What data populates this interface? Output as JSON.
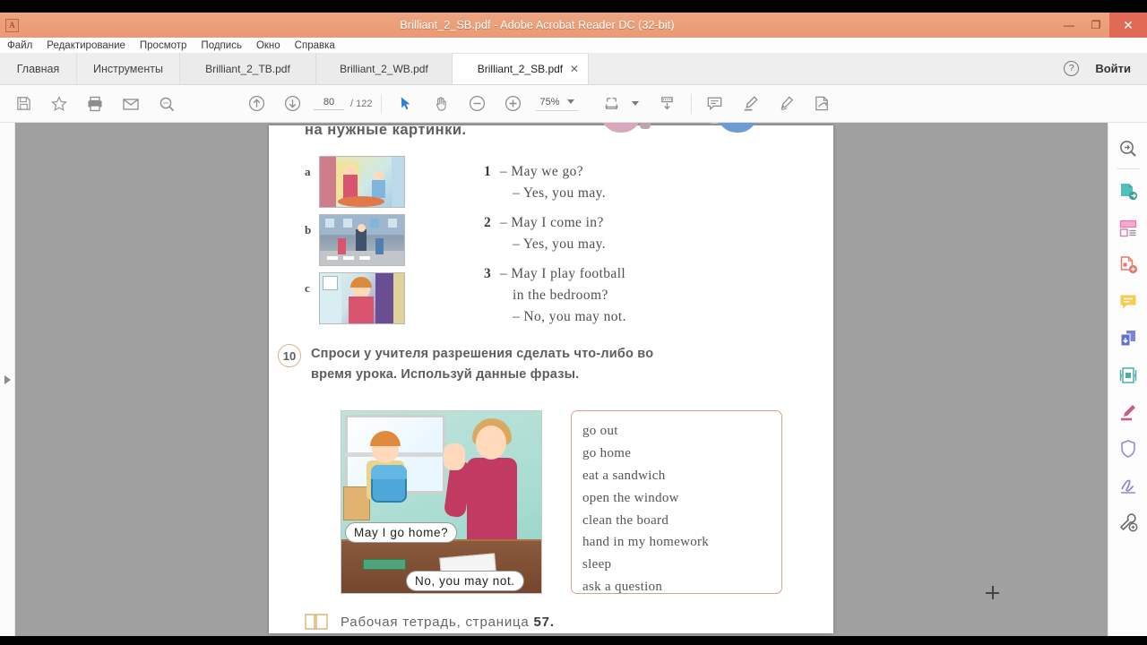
{
  "window": {
    "title": "Brilliant_2_SB.pdf - Adobe Acrobat Reader DC (32-bit)",
    "logo_letter": "A",
    "minimize": "—",
    "maximize": "❐",
    "close": "✕",
    "titlebar_color": "#e99a74"
  },
  "menubar": {
    "items": [
      {
        "label": "Файл"
      },
      {
        "label": "Редактирование"
      },
      {
        "label": "Просмотр"
      },
      {
        "label": "Подпись"
      },
      {
        "label": "Окно"
      },
      {
        "label": "Справка"
      }
    ]
  },
  "tabbar": {
    "nav": [
      {
        "label": "Главная"
      },
      {
        "label": "Инструменты"
      }
    ],
    "documents": [
      {
        "label": "Brilliant_2_TB.pdf",
        "active": false
      },
      {
        "label": "Brilliant_2_WB.pdf",
        "active": false
      },
      {
        "label": "Brilliant_2_SB.pdf",
        "active": true,
        "close": "✕"
      }
    ],
    "help_glyph": "?",
    "signin_label": "Войти"
  },
  "toolbar": {
    "icons_left": [
      "save-icon",
      "bookmark-star-icon",
      "print-icon",
      "email-icon",
      "search-icon"
    ],
    "page_prev": "previous-page-icon",
    "page_next": "next-page-icon",
    "page_current": "80",
    "page_separator": "/",
    "page_total": "122",
    "select_tool": "select-arrow-icon",
    "hand_tool": "hand-tool-icon",
    "zoom_out": "zoom-out-icon",
    "zoom_in": "zoom-in-icon",
    "zoom_value": "75%",
    "fit_page": "fit-page-icon",
    "page_display": "page-display-icon",
    "comment": "comment-icon",
    "highlight": "highlight-icon",
    "sign": "sign-pen-icon",
    "fill_sign": "fill-and-sign-icon"
  },
  "document": {
    "heading": "на нужные картинки.",
    "exercise9": {
      "pictures": [
        {
          "letter": "a"
        },
        {
          "letter": "b"
        },
        {
          "letter": "c"
        }
      ],
      "dialogues": [
        {
          "num": "1",
          "lines": [
            "– May  we  go?",
            "– Yes,  you  may."
          ]
        },
        {
          "num": "2",
          "lines": [
            "– May  I  come  in?",
            "– Yes,  you  may."
          ]
        },
        {
          "num": "3",
          "lines": [
            "– May  I  play  football",
            "in  the  bedroom?",
            "– No,  you  may  not."
          ]
        }
      ]
    },
    "exercise10": {
      "number": "10",
      "instruction": "Спроси у учителя разрешения сделать что-либо во время урока. Используй данные фразы.",
      "scene": {
        "bubble_student": "May  I  go  home?",
        "bubble_teacher": "No,  you  may  not."
      },
      "phrases": [
        "go out",
        "go home",
        "eat a sandwich",
        "open the window",
        "clean the board",
        "hand in my homework",
        "sleep",
        "ask a question"
      ]
    },
    "footer": {
      "text": "Рабочая  тетрадь,  страница ",
      "page": "57."
    }
  },
  "toolrail": {
    "items": [
      {
        "name": "search-tool-icon"
      },
      {
        "name": "export-pdf-icon"
      },
      {
        "name": "organize-pages-icon"
      },
      {
        "name": "create-pdf-icon"
      },
      {
        "name": "comment-tool-icon"
      },
      {
        "name": "combine-files-icon"
      },
      {
        "name": "compress-pdf-icon"
      },
      {
        "name": "redact-icon"
      },
      {
        "name": "protect-icon"
      },
      {
        "name": "fill-sign-tool-icon"
      },
      {
        "name": "more-tools-icon"
      }
    ]
  },
  "scrollbar": {
    "up_glyph": "⌃",
    "down_glyph": "⌄"
  }
}
